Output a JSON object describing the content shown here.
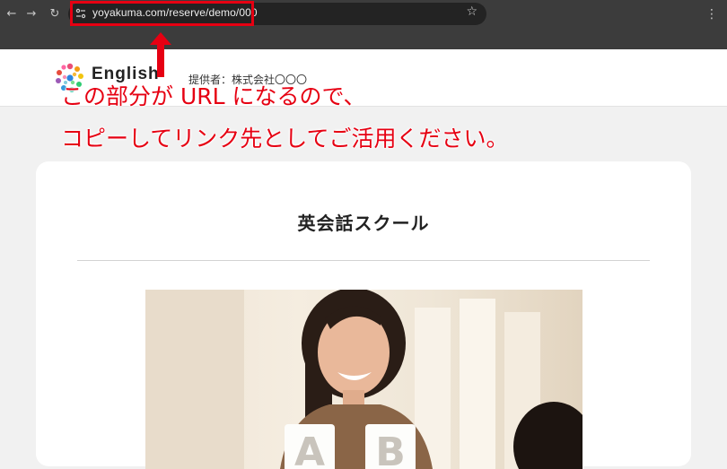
{
  "browser": {
    "back_icon": "arrow-left-icon",
    "forward_icon": "arrow-right-icon",
    "reload_icon": "reload-icon",
    "url": "yoyakuma.com/reserve/demo/000",
    "bookmark_icon": "star-icon",
    "menu_icon": "kebab-menu-icon",
    "highlight_color": "#e60012"
  },
  "site": {
    "logo_text": "English",
    "provider": "提供者：株式会社〇〇〇"
  },
  "annotation": {
    "line1": "この部分が URL になるので、",
    "line2": "コピーしてリンク先としてご活用ください。"
  },
  "card": {
    "title": "英会話スクール"
  }
}
